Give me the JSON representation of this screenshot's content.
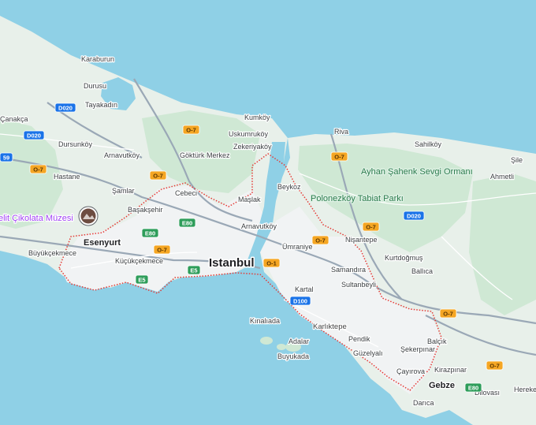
{
  "map": {
    "city_label": "Istanbul",
    "colors": {
      "water": "#8fd0e6",
      "land": "#e8f0ea",
      "forest": "#cfe8d4",
      "park": "#b9dfc4",
      "urban": "#f1f3f4",
      "road": "#ffffff",
      "highway": "#9aa8b6",
      "boundary": "#e53935",
      "shield_orange": "#f5a623",
      "shield_green": "#2e9d5a",
      "shield_blue": "#1a73e8"
    },
    "place_labels": [
      {
        "text": "Karaburun"
      },
      {
        "text": "Durusu"
      },
      {
        "text": "Tayakadın"
      },
      {
        "text": "Çanakça"
      },
      {
        "text": "Dursunköy"
      },
      {
        "text": "Arnavutköy"
      },
      {
        "text": "Hastane"
      },
      {
        "text": "Kumköy"
      },
      {
        "text": "Uskumruköy"
      },
      {
        "text": "Zekeriyaköy"
      },
      {
        "text": "Göktürk Merkez"
      },
      {
        "text": "Şamlar"
      },
      {
        "text": "Cebeci"
      },
      {
        "text": "Başakşehir"
      },
      {
        "text": "Riva"
      },
      {
        "text": "Sahilköy"
      },
      {
        "text": "Şile"
      },
      {
        "text": "Ahmetli"
      },
      {
        "text": "Beykoz"
      },
      {
        "text": "Maşlak"
      },
      {
        "text": "Arnavutköy"
      },
      {
        "text": "Ümraniye"
      },
      {
        "text": "Nişantepe"
      },
      {
        "text": "Kurtdoğmuş"
      },
      {
        "text": "Ballıca"
      },
      {
        "text": "Büyükçekmece"
      },
      {
        "text": "Küçükçekmece"
      },
      {
        "text": "Samandıra"
      },
      {
        "text": "Sultanbeyli"
      },
      {
        "text": "Kartal"
      },
      {
        "text": "Kınalıada"
      },
      {
        "text": "Adalar"
      },
      {
        "text": "Buyukada"
      },
      {
        "text": "Pendik"
      },
      {
        "text": "Güzelyalı"
      },
      {
        "text": "Balçık"
      },
      {
        "text": "Şekerpınar"
      },
      {
        "text": "Çayırova"
      },
      {
        "text": "Kirazpınar"
      },
      {
        "text": "Gebze"
      },
      {
        "text": "Dilovası"
      },
      {
        "text": "Hereke"
      },
      {
        "text": "Darıca"
      }
    ],
    "district_labels": [
      {
        "text": "Karlıktepe"
      }
    ],
    "park_labels": [
      {
        "text": "Ayhan Şahenk Sevgi Ormanı"
      },
      {
        "text": "Polonezköy Tabiat Parkı"
      }
    ],
    "town_labels": [
      {
        "text": "Esenyurt"
      },
      {
        "text": "Gebze"
      }
    ],
    "poi": {
      "text": "elit Çikolata Müzesi",
      "icon": "museum-photo-marker"
    },
    "road_shields": [
      {
        "text": "D020",
        "kind": "blue"
      },
      {
        "text": "D020",
        "kind": "blue"
      },
      {
        "text": "D020",
        "kind": "blue"
      },
      {
        "text": "O-7",
        "kind": "orange"
      },
      {
        "text": "O-7",
        "kind": "orange"
      },
      {
        "text": "O-7",
        "kind": "orange"
      },
      {
        "text": "O-7",
        "kind": "orange"
      },
      {
        "text": "O-7",
        "kind": "orange"
      },
      {
        "text": "O-7",
        "kind": "orange"
      },
      {
        "text": "O-7",
        "kind": "orange"
      },
      {
        "text": "O-7",
        "kind": "orange"
      },
      {
        "text": "O-7",
        "kind": "orange"
      },
      {
        "text": "E80",
        "kind": "green"
      },
      {
        "text": "E80",
        "kind": "green"
      },
      {
        "text": "E80",
        "kind": "green"
      },
      {
        "text": "E5",
        "kind": "green"
      },
      {
        "text": "E5",
        "kind": "green"
      },
      {
        "text": "O-1",
        "kind": "orange"
      },
      {
        "text": "D100",
        "kind": "blue"
      },
      {
        "text": "59",
        "kind": "blue"
      }
    ]
  }
}
